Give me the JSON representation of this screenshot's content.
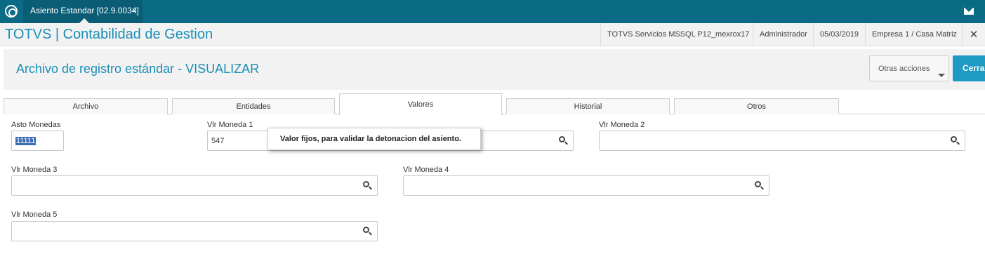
{
  "topbar": {
    "tab_label": "Asiento Estandar [02.9.0034]",
    "tab_close": "×",
    "icons": [
      "totvs-logo-icon",
      "mail-icon"
    ]
  },
  "appbar": {
    "title": "TOTVS | Contabilidad de Gestion",
    "server": "TOTVS Servicios MSSQL P12_mexrox17",
    "user": "Administrador",
    "date": "05/03/2019",
    "company": "Empresa 1 / Casa Matriz",
    "close": "✕"
  },
  "page": {
    "title": "Archivo de registro estándar - VISUALIZAR",
    "otras_acciones": "Otras acciones",
    "cerrar": "Cerra"
  },
  "tabs": [
    {
      "label": "Archivo",
      "active": false
    },
    {
      "label": "Entidades",
      "active": false
    },
    {
      "label": "Valores",
      "active": true
    },
    {
      "label": "Historial",
      "active": false
    },
    {
      "label": "Otros",
      "active": false
    }
  ],
  "form": {
    "asto_monedas": {
      "label": "Asto Monedas",
      "value": "11111"
    },
    "vlr_moneda_1": {
      "label": "Vlr Moneda 1",
      "value": "547"
    },
    "vlr_moneda_2": {
      "label": "Vlr Moneda 2",
      "value": ""
    },
    "vlr_moneda_3": {
      "label": "Vlr Moneda 3",
      "value": ""
    },
    "vlr_moneda_4": {
      "label": "Vlr Moneda 4",
      "value": ""
    },
    "vlr_moneda_5": {
      "label": "Vlr Moneda 5",
      "value": ""
    }
  },
  "tooltip": "Valor fijos, para validar la detonacion del asiento.",
  "colors": {
    "topbar": "#0b6a84",
    "accent": "#1a8fb7",
    "primary_button": "#1e9ac4",
    "selection": "#3d6fb6"
  }
}
